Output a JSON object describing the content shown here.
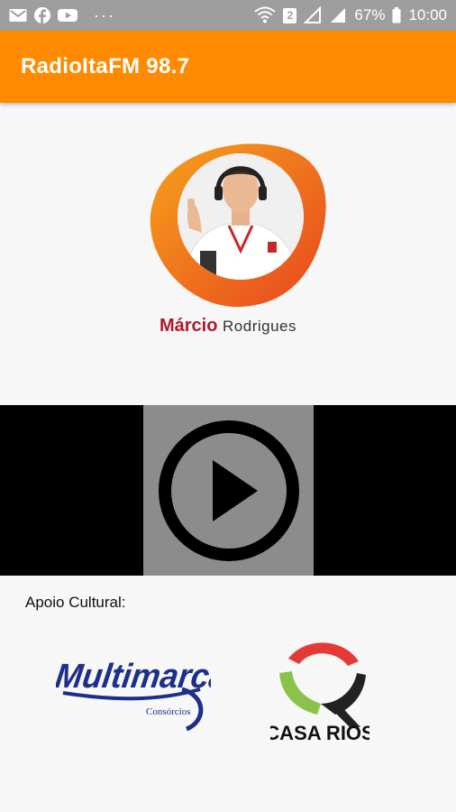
{
  "status_bar": {
    "notification_icons": [
      "gmail-icon",
      "facebook-icon",
      "youtube-icon"
    ],
    "more": "···",
    "sim_badge": "2",
    "battery": "67%",
    "time": "10:00"
  },
  "app_bar": {
    "title": "RadioItaFM 98.7",
    "color": "#ff8a00"
  },
  "logo": {
    "first_name": "Márcio",
    "last_name": "Rodrigues"
  },
  "player": {
    "button_icon": "play-circle-icon"
  },
  "support": {
    "label": "Apoio Cultural:",
    "sponsors": [
      {
        "name": "Multimarcas",
        "subtitle": "Consórcios"
      },
      {
        "name": "CASA RIOS"
      }
    ]
  }
}
